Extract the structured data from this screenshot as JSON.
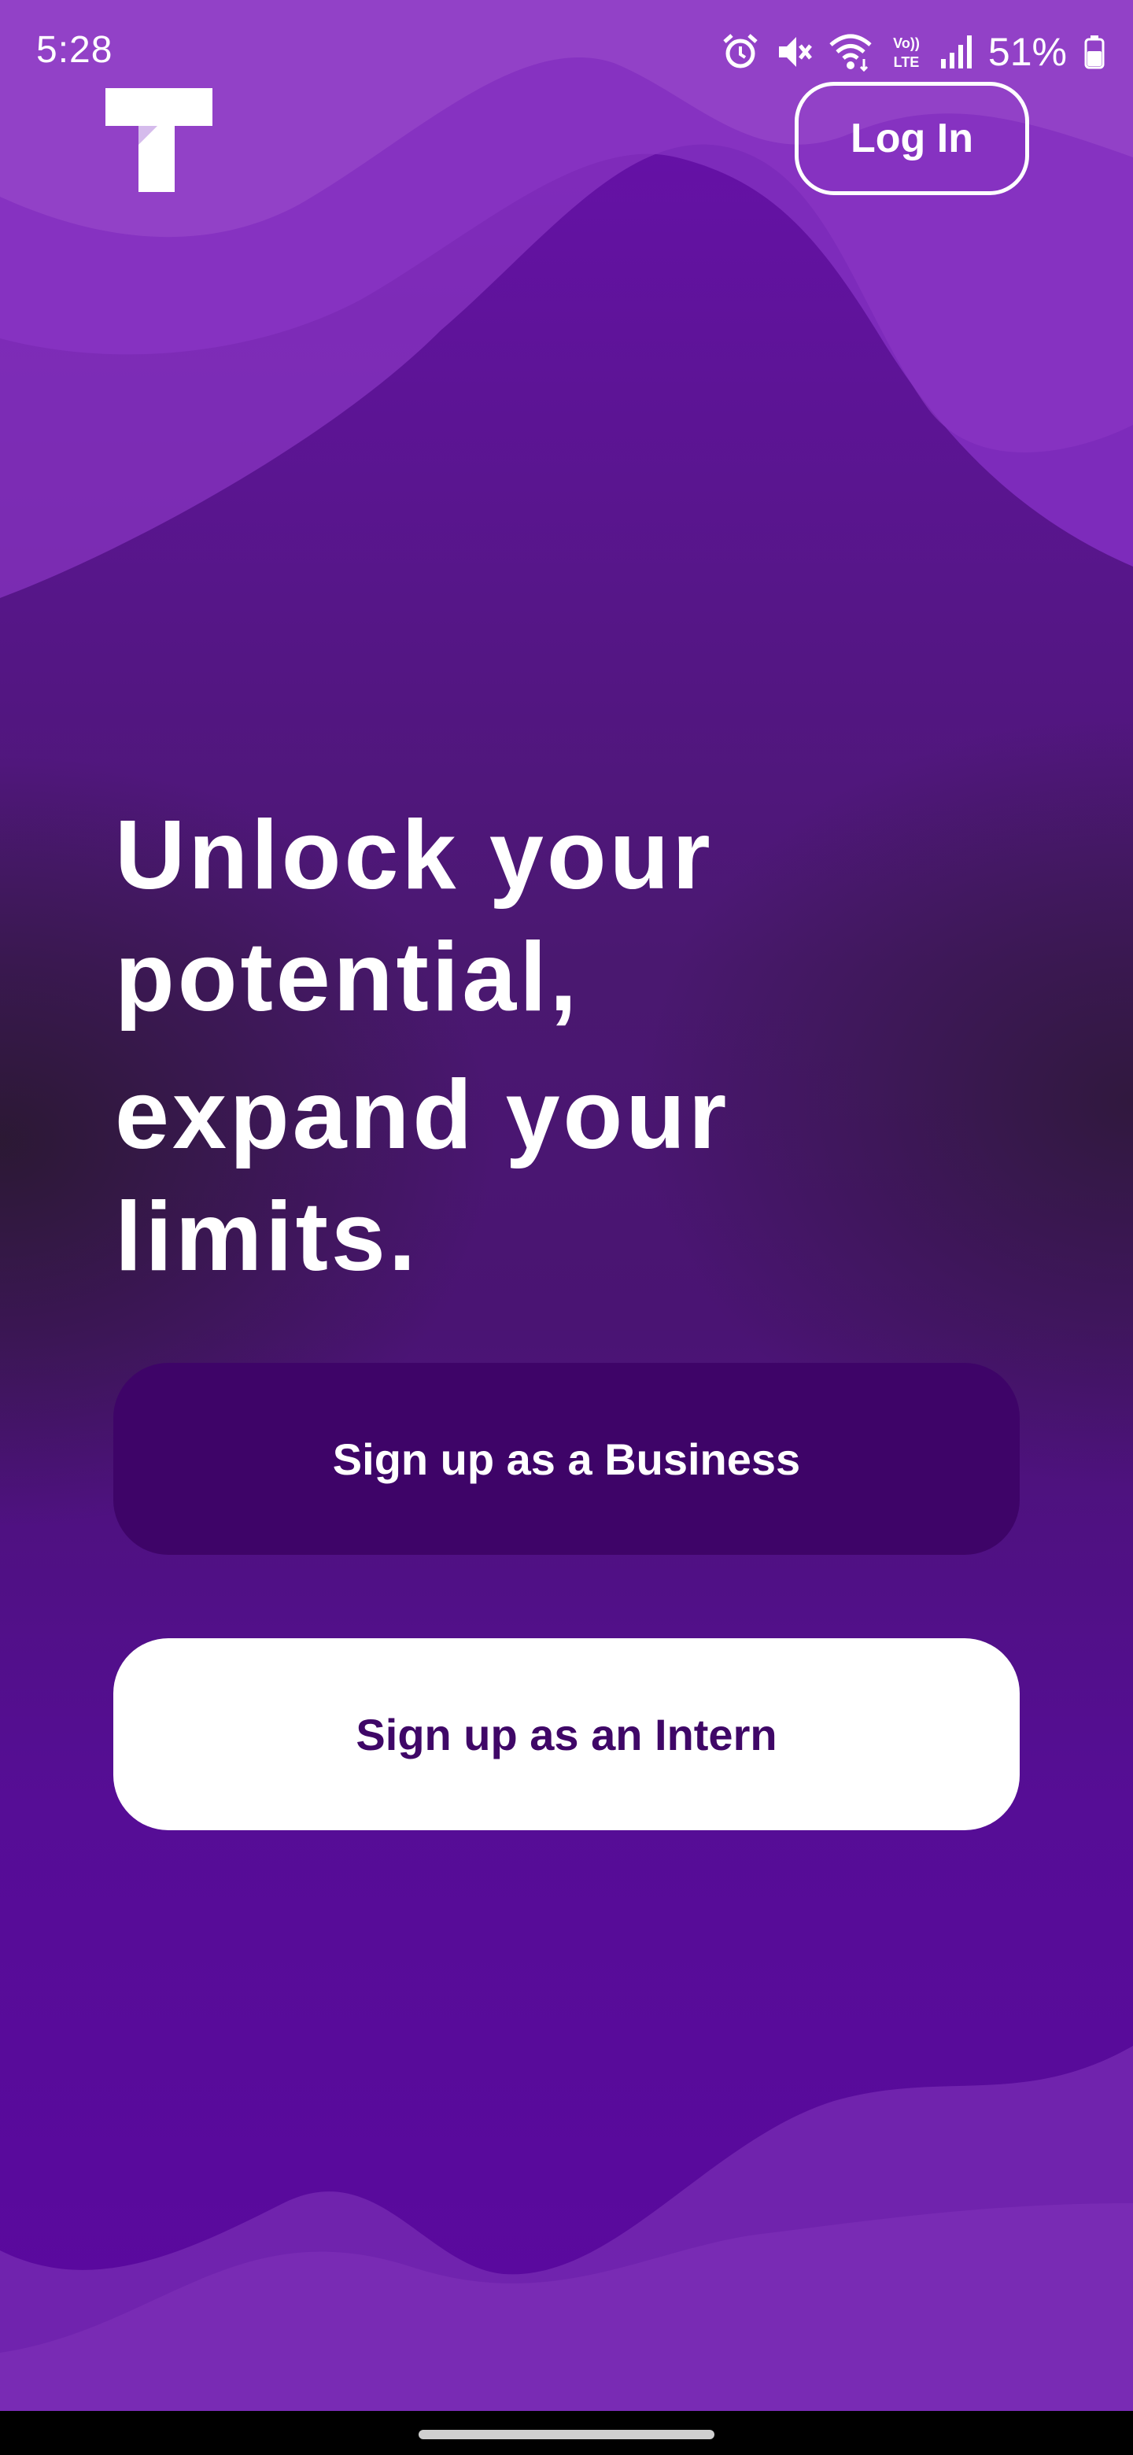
{
  "status_bar": {
    "time": "5:28",
    "battery_percent": "51%",
    "icons": [
      "alarm-icon",
      "mute-icon",
      "wifi-icon",
      "volte-icon",
      "signal-icon",
      "battery-icon"
    ]
  },
  "header": {
    "logo_icon": "t-logo-icon",
    "login_label": "Log In"
  },
  "hero": {
    "headline_line1": "Unlock your",
    "headline_line2": "potential,",
    "headline_line3": "expand your",
    "headline_line4": "limits."
  },
  "actions": {
    "signup_business_label": "Sign up as a Business",
    "signup_intern_label": "Sign up as an Intern"
  },
  "colors": {
    "background_primary": "#5b08a0",
    "wave_light": "#8e3cc4",
    "business_button": "#3e0468",
    "intern_button": "#ffffff",
    "intern_button_text": "#3f0767"
  }
}
